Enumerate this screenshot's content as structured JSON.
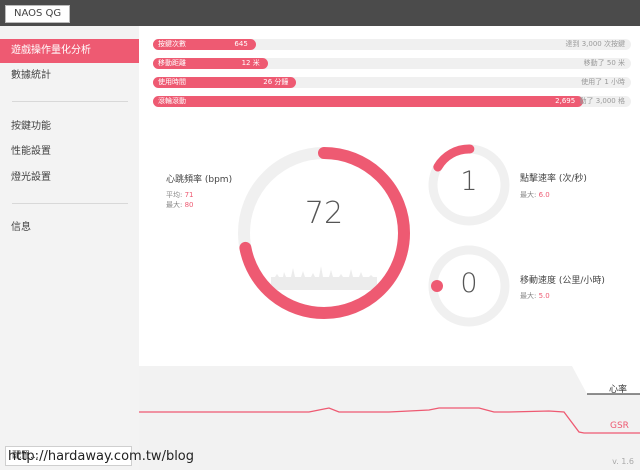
{
  "app": {
    "title": "NAOS QG",
    "version": "v. 1.6"
  },
  "sidebar": {
    "items": [
      {
        "label": "遊戲操作量化分析",
        "active": true
      },
      {
        "label": "數據統計",
        "active": false
      },
      {
        "label": "按鍵功能",
        "active": false
      },
      {
        "label": "性能設置",
        "active": false
      },
      {
        "label": "燈光設置",
        "active": false
      },
      {
        "label": "信息",
        "active": false
      }
    ],
    "bottom_button": "配置..."
  },
  "stats": [
    {
      "label": "按鍵次數",
      "value": "645",
      "goal": "達到 3,000 次按鍵",
      "fill": 0.215
    },
    {
      "label": "移動距離",
      "value": "12 米",
      "goal": "移動了 50 米",
      "fill": 0.24
    },
    {
      "label": "使用時間",
      "value": "26 分鐘",
      "goal": "使用了 1 小時",
      "fill": 0.3
    },
    {
      "label": "滾輪滾動",
      "value": "2,695",
      "goal": "動了 3,000 格",
      "fill": 0.9
    }
  ],
  "heart_rate": {
    "label": "心跳頻率 (bpm)",
    "avg_label": "平均:",
    "avg_value": "71",
    "max_label": "最大:",
    "max_value": "80",
    "current": "72",
    "ring_fraction": 0.72
  },
  "click_rate": {
    "label": "點擊速率 (次/秒)",
    "max_label": "最大:",
    "max_value": "6.0",
    "current": "1",
    "ring_fraction": 0.17
  },
  "move_speed": {
    "label": "移動速度 (公里/小時)",
    "max_label": "最大:",
    "max_value": "5.0",
    "current": "0",
    "ring_fraction": 0.02
  },
  "bottom_chart": {
    "heart_label": "心率",
    "gsr_label": "GSR"
  },
  "colors": {
    "accent": "#ee5a72",
    "track": "#f0f0f0",
    "titlebar": "#4b4b4b"
  },
  "watermark": "http://hardaway.com.tw/blog"
}
